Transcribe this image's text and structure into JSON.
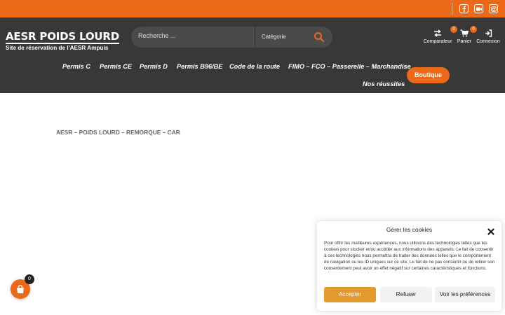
{
  "site": {
    "title": "AESR POIDS LOURD",
    "tagline": "Site de réservation de l'AESR Ampuis"
  },
  "social": [
    "facebook-icon",
    "video-icon",
    "instagram-icon"
  ],
  "search": {
    "placeholder": "Recherche ...",
    "category": "Catégorie"
  },
  "header_icons": {
    "compare": {
      "label": "Comparateur",
      "count": "0"
    },
    "cart": {
      "label": "Panier",
      "count": "0"
    },
    "login": {
      "label": "Connexion"
    }
  },
  "nav": {
    "items": [
      "Permis C",
      "Permis CE",
      "Permis D",
      "Permis B96/BE",
      "Code de la route",
      "FIMO – FCO – Passerelle – Marchandise",
      "Nos réussites"
    ],
    "shop_button": "Boutique"
  },
  "breadcrumb": "AESR – POIDS LOURD – REMORQUE – CAR",
  "floating_cart": {
    "count": "0"
  },
  "cookie": {
    "title": "Gérer les cookies",
    "text": "Pour offrir les meilleures expériences, nous utilisons des technologies telles que les cookies pour stocker et/ou accéder aux informations des appareils. Le fait de consentir à ces technologies nous permettra de traiter des données telles que le comportement de navigation ou les ID uniques sur ce site. Le fait de ne pas consentir ou de retirer son consentement peut avoir un effet négatif sur certaines caractéristiques et fonctions.",
    "accept": "Accepter",
    "refuse": "Refuser",
    "preferences": "Voir les préférences"
  },
  "colors": {
    "accent": "#ea6a1a",
    "header_bg": "#383838",
    "accept_bg": "#e29a2e"
  }
}
